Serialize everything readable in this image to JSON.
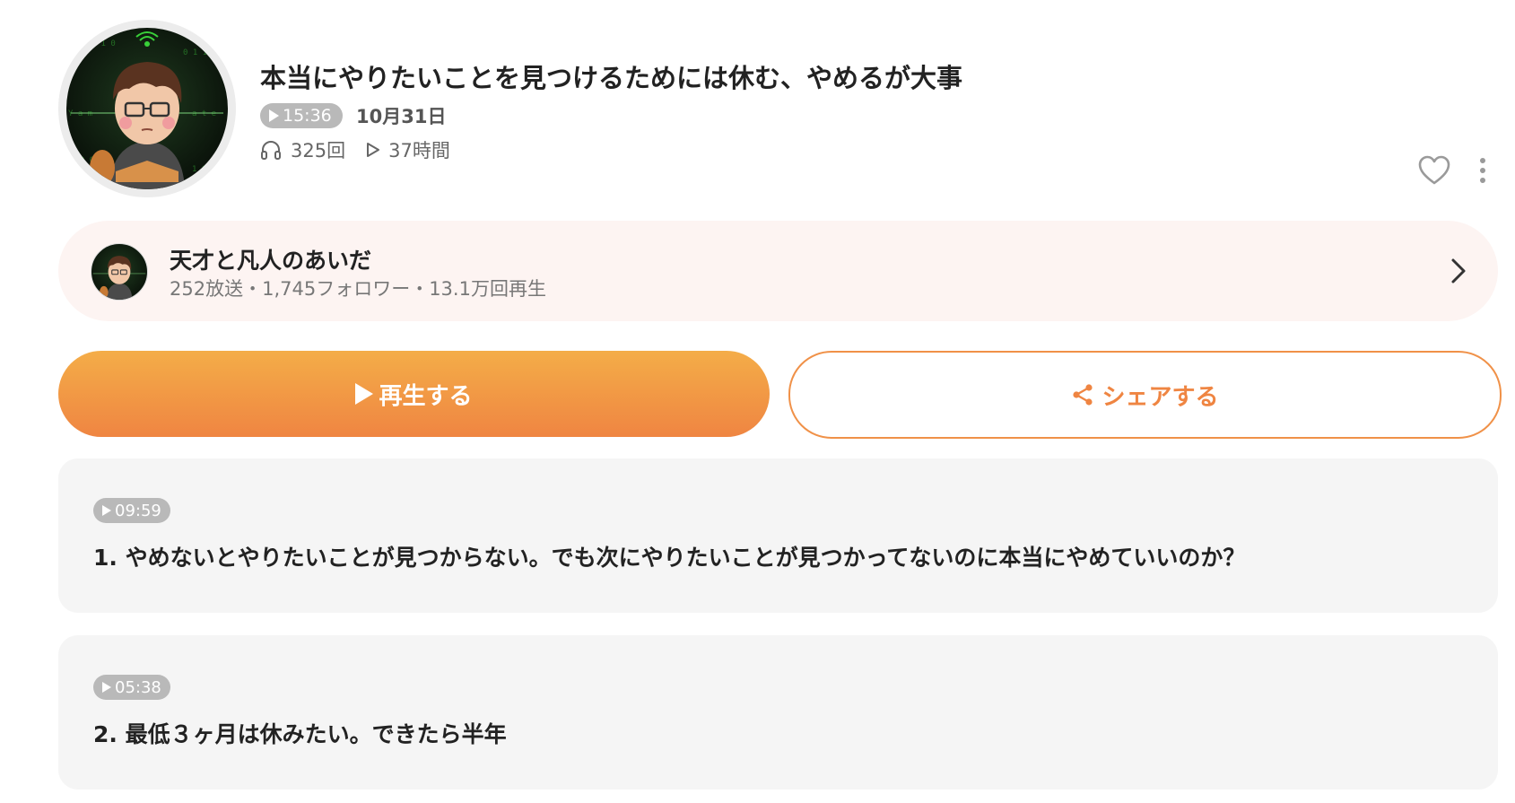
{
  "episode": {
    "title": "本当にやりたいことを見つけるためには休む、やめるが大事",
    "duration": "15:36",
    "date": "10月31日",
    "plays": "325回",
    "listen_time": "37時間"
  },
  "channel": {
    "name": "天才と凡人のあいだ",
    "meta": "252放送・1,745フォロワー・13.1万回再生"
  },
  "actions": {
    "play_label": "再生する",
    "share_label": "シェアする"
  },
  "chapters": [
    {
      "time": "09:59",
      "text": "1.  やめないとやりたいことが見つからない。でも次にやりたいことが見つかってないのに本当にやめていいのか？"
    },
    {
      "time": "05:38",
      "text": "2.  最低３ヶ月は休みたい。できたら半年"
    }
  ],
  "colors": {
    "accent_orange": "#ef8542",
    "accent_gradient_top": "#f4ad48",
    "channel_bg": "#fdf4f2",
    "chapter_bg": "#f5f5f5",
    "pill_gray": "#b9b9b9"
  },
  "icons": {
    "avatar": "podcaster-avatar",
    "plays": "headphones-icon",
    "listen_time": "play-outline-icon",
    "favorite": "heart-icon",
    "more": "more-vertical-icon",
    "channel_chevron": "chevron-right-icon",
    "share": "share-icon"
  }
}
